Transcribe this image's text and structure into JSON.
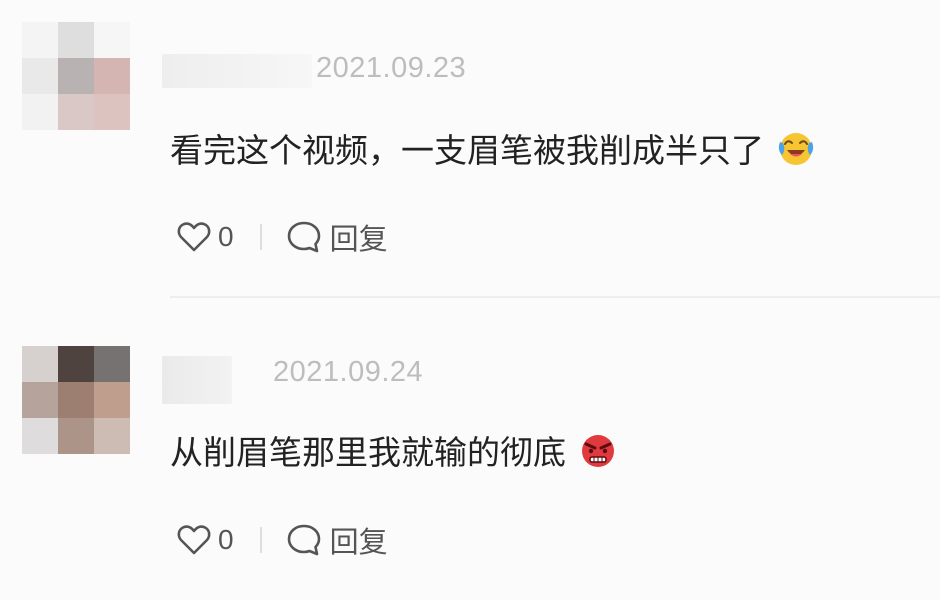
{
  "comments": [
    {
      "timestamp": "2021.09.23",
      "text": "看完这个视频，一支眉笔被我削成半只了",
      "emoji_icon": "laughing-crying-emoji",
      "like_count": "0",
      "reply_label": "回复"
    },
    {
      "timestamp": "2021.09.24",
      "text": "从削眉笔那里我就输的彻底",
      "emoji_icon": "angry-face-emoji",
      "like_count": "0",
      "reply_label": "回复"
    }
  ],
  "colors": {
    "background": "#fbfbfb",
    "text": "#222222",
    "muted": "#bdbdbd",
    "action": "#555555"
  }
}
